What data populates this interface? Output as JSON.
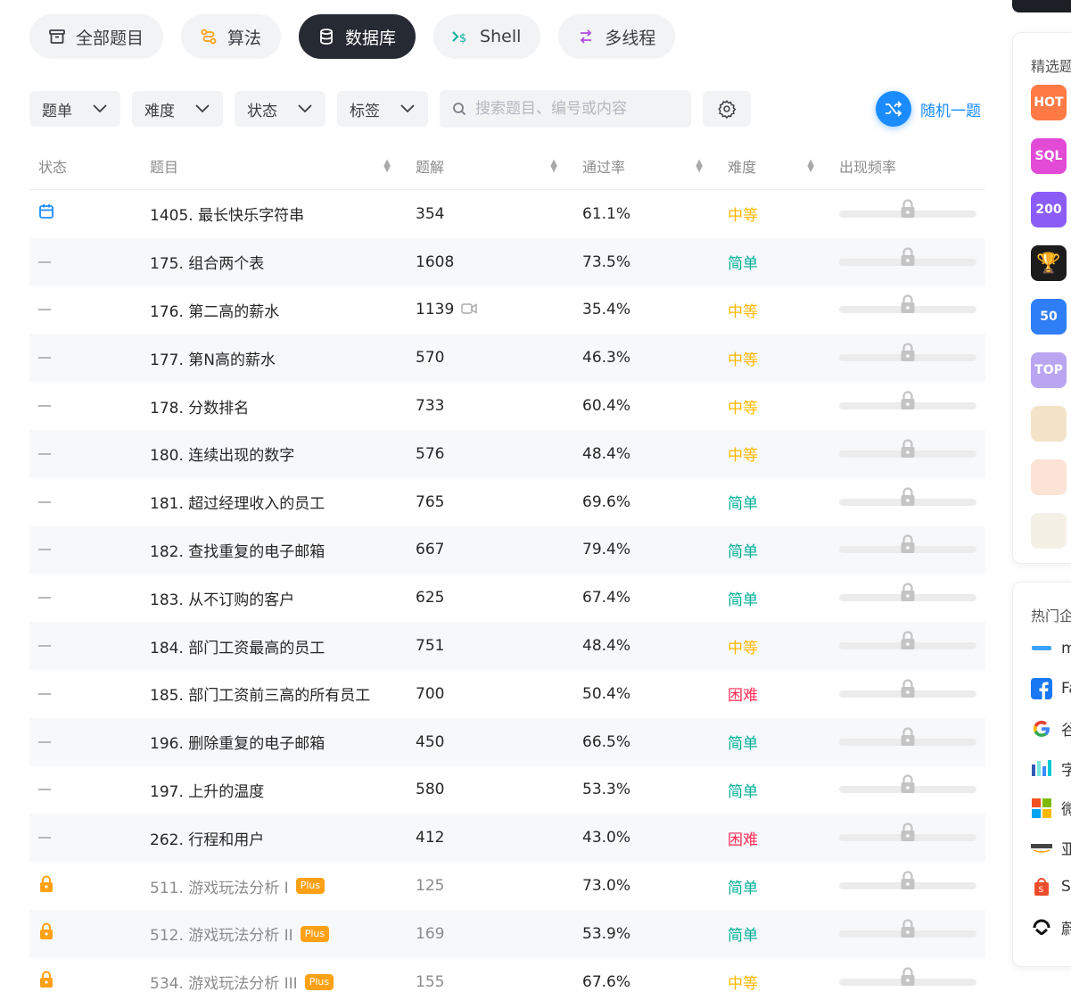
{
  "categories": [
    {
      "label": "全部题目",
      "icon": "archive-icon",
      "active": false
    },
    {
      "label": "算法",
      "icon": "algorithm-icon",
      "active": false
    },
    {
      "label": "数据库",
      "icon": "database-icon",
      "active": true
    },
    {
      "label": "Shell",
      "icon": "terminal-icon",
      "active": false
    },
    {
      "label": "多线程",
      "icon": "threads-icon",
      "active": false
    }
  ],
  "filters": {
    "problem_list": "题单",
    "difficulty": "难度",
    "status": "状态",
    "tags": "标签",
    "search_placeholder": "搜索题目、编号或内容"
  },
  "random_label": "随机一题",
  "table": {
    "headers": {
      "status": "状态",
      "title": "题目",
      "solutions": "题解",
      "acceptance": "通过率",
      "difficulty": "难度",
      "frequency": "出现频率"
    },
    "rows": [
      {
        "status": "calendar",
        "title": "1405. 最长快乐字符串",
        "solutions": "354",
        "acceptance": "61.1%",
        "difficulty": "中等",
        "plus": "",
        "video": false
      },
      {
        "status": "none",
        "title": "175. 组合两个表",
        "solutions": "1608",
        "acceptance": "73.5%",
        "difficulty": "简单",
        "plus": "",
        "video": false
      },
      {
        "status": "none",
        "title": "176. 第二高的薪水",
        "solutions": "1139",
        "acceptance": "35.4%",
        "difficulty": "中等",
        "plus": "",
        "video": true
      },
      {
        "status": "none",
        "title": "177. 第N高的薪水",
        "solutions": "570",
        "acceptance": "46.3%",
        "difficulty": "中等",
        "plus": "",
        "video": false
      },
      {
        "status": "none",
        "title": "178. 分数排名",
        "solutions": "733",
        "acceptance": "60.4%",
        "difficulty": "中等",
        "plus": "",
        "video": false
      },
      {
        "status": "none",
        "title": "180. 连续出现的数字",
        "solutions": "576",
        "acceptance": "48.4%",
        "difficulty": "中等",
        "plus": "",
        "video": false
      },
      {
        "status": "none",
        "title": "181. 超过经理收入的员工",
        "solutions": "765",
        "acceptance": "69.6%",
        "difficulty": "简单",
        "plus": "",
        "video": false
      },
      {
        "status": "none",
        "title": "182. 查找重复的电子邮箱",
        "solutions": "667",
        "acceptance": "79.4%",
        "difficulty": "简单",
        "plus": "",
        "video": false
      },
      {
        "status": "none",
        "title": "183. 从不订购的客户",
        "solutions": "625",
        "acceptance": "67.4%",
        "difficulty": "简单",
        "plus": "",
        "video": false
      },
      {
        "status": "none",
        "title": "184. 部门工资最高的员工",
        "solutions": "751",
        "acceptance": "48.4%",
        "difficulty": "中等",
        "plus": "",
        "video": false
      },
      {
        "status": "none",
        "title": "185. 部门工资前三高的所有员工",
        "solutions": "700",
        "acceptance": "50.4%",
        "difficulty": "困难",
        "plus": "",
        "video": false
      },
      {
        "status": "none",
        "title": "196. 删除重复的电子邮箱",
        "solutions": "450",
        "acceptance": "66.5%",
        "difficulty": "简单",
        "plus": "",
        "video": false
      },
      {
        "status": "none",
        "title": "197. 上升的温度",
        "solutions": "580",
        "acceptance": "53.3%",
        "difficulty": "简单",
        "plus": "",
        "video": false
      },
      {
        "status": "none",
        "title": "262. 行程和用户",
        "solutions": "412",
        "acceptance": "43.0%",
        "difficulty": "困难",
        "plus": "",
        "video": false
      },
      {
        "status": "locked",
        "title": "511. 游戏玩法分析 I",
        "solutions": "125",
        "acceptance": "73.0%",
        "difficulty": "简单",
        "plus": "Plus",
        "video": false
      },
      {
        "status": "locked",
        "title": "512. 游戏玩法分析 II",
        "solutions": "169",
        "acceptance": "53.9%",
        "difficulty": "简单",
        "plus": "Plus",
        "video": false
      },
      {
        "status": "locked",
        "title": "534. 游戏玩法分析 III",
        "solutions": "155",
        "acceptance": "67.6%",
        "difficulty": "中等",
        "plus": "Plus",
        "video": false
      }
    ]
  },
  "colors": {
    "easy": "#00af9b",
    "medium": "#ffb800",
    "hard": "#ff2d55",
    "accent": "#1a8cff",
    "plus": "#ffa116"
  },
  "side": {
    "featured_title": "精选题",
    "featured": [
      {
        "label": "HOT",
        "color": "#ff7a45"
      },
      {
        "label": "SQL",
        "color": "#e14bd6"
      },
      {
        "label": "200",
        "color": "#8b5cf6"
      },
      {
        "label": "",
        "color": "#1c1c1c"
      },
      {
        "label": "50",
        "color": "#2f7ef5"
      },
      {
        "label": "TOP",
        "color": "#b9a5f0"
      },
      {
        "label": "",
        "color": "#f3e4c8"
      },
      {
        "label": "",
        "color": "#fbe3d5"
      },
      {
        "label": "",
        "color": "#f5f0e6"
      }
    ],
    "companies_title": "热门企",
    "companies": [
      {
        "name": "m",
        "logo": "meituan-logo"
      },
      {
        "name": "Fa",
        "logo": "facebook-logo"
      },
      {
        "name": "谷",
        "logo": "google-logo"
      },
      {
        "name": "字",
        "logo": "bytedance-logo"
      },
      {
        "name": "微",
        "logo": "microsoft-logo"
      },
      {
        "name": "亚",
        "logo": "amazon-logo"
      },
      {
        "name": "S",
        "logo": "shopee-logo"
      },
      {
        "name": "蔚",
        "logo": "nio-logo"
      }
    ]
  }
}
